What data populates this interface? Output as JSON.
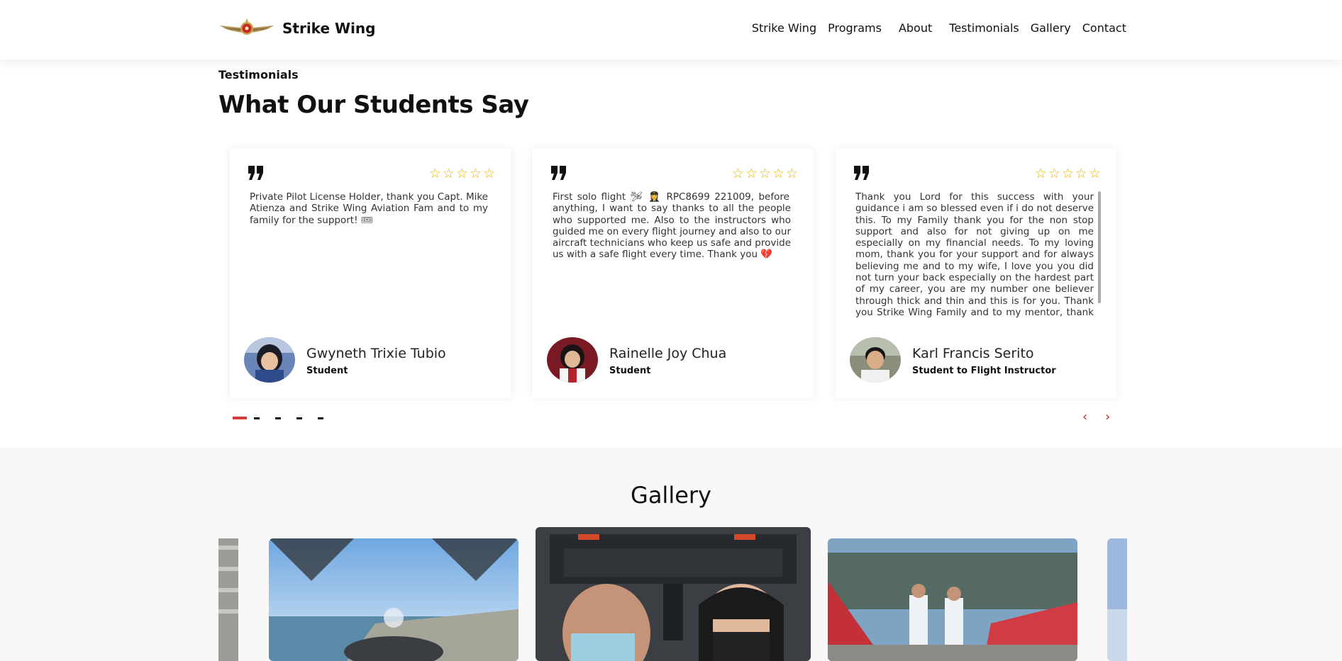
{
  "header": {
    "brand_name": "Strike Wing",
    "nav": [
      "Strike Wing",
      "Programs",
      "About",
      "Testimonials",
      "Gallery",
      "Contact"
    ]
  },
  "testimonials": {
    "label": "Testimonials",
    "title": "What Our Students Say",
    "rating_stars": 5,
    "cards": [
      {
        "text": "Private Pilot License Holder, thank you Capt. Mike Atienza and Strike Wing Aviation Fam and to my family for the support! 🎟",
        "name": "Gwyneth Trixie Tubio",
        "role": "Student"
      },
      {
        "text": "First solo flight 🛩 👩‍✈️ RPC8699 221009, before anything, I want to say thanks to all the people who supported me. Also to the instructors who guided me on every flight journey and also to our aircraft technicians who keep us safe and provide us with a safe flight every time. Thank you 💔",
        "name": "Rainelle Joy Chua",
        "role": "Student"
      },
      {
        "text": "Thank you Lord for this success with your guidance i am so blessed even if i do not deserve this. To my Family thank you for the non stop support and also for not giving up on me especially on my financial needs. To my loving mom, thank you for your support and for always believing me and to my wife, I love you you did not turn your back especially on the hardest part of my career, you are my number one believer through thick and thin and this is for you. Thank you Strike Wing Family and to my mentor, thank you so mcg kapitan for this opportunity",
        "name": "Karl Francis Serito",
        "role": "Student to Flight Instructor"
      }
    ],
    "pagination_count": 5,
    "active_page": 1
  },
  "gallery": {
    "title": "Gallery"
  },
  "colors": {
    "accent_red": "#d93a3a",
    "star_gold": "#e8b400"
  }
}
